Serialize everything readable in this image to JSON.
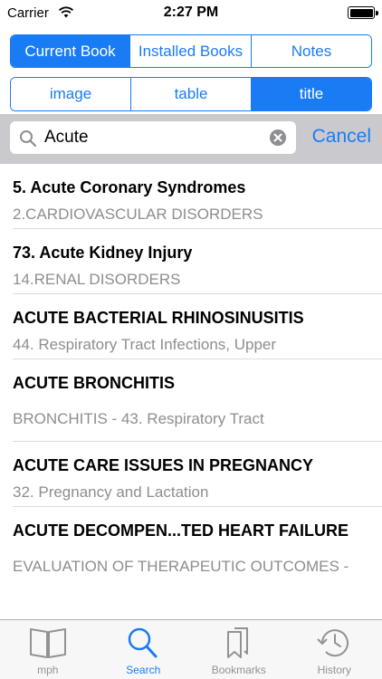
{
  "status_bar": {
    "carrier": "Carrier",
    "time": "2:27 PM"
  },
  "book_tabs": [
    {
      "label": "Current Book",
      "active": true
    },
    {
      "label": "Installed Books",
      "active": false
    },
    {
      "label": "Notes",
      "active": false
    }
  ],
  "filter_tabs": [
    {
      "label": "image",
      "active": false
    },
    {
      "label": "table",
      "active": false
    },
    {
      "label": "title",
      "active": true
    }
  ],
  "search": {
    "value": "Acute",
    "cancel_label": "Cancel"
  },
  "results": [
    {
      "title": "5. Acute Coronary Syndromes",
      "subtitle": "2.CARDIOVASCULAR DISORDERS"
    },
    {
      "title": "73. Acute Kidney Injury",
      "subtitle": "14.RENAL DISORDERS"
    },
    {
      "title": "ACUTE BACTERIAL RHINOSINUSITIS",
      "subtitle": "44. Respiratory Tract Infections, Upper"
    },
    {
      "title": "ACUTE BRONCHITIS",
      "subtitle": "BRONCHITIS - 43. Respiratory Tract"
    },
    {
      "title": "ACUTE CARE ISSUES IN PREGNANCY",
      "subtitle": "32. Pregnancy and Lactation"
    },
    {
      "title": "ACUTE DECOMPEN...TED HEART FAILURE",
      "subtitle": "EVALUATION OF THERAPEUTIC OUTCOMES -"
    }
  ],
  "tab_bar": [
    {
      "label": "mph",
      "icon": "book-icon",
      "active": false
    },
    {
      "label": "Search",
      "icon": "search-icon",
      "active": true
    },
    {
      "label": "Bookmarks",
      "icon": "bookmarks-icon",
      "active": false
    },
    {
      "label": "History",
      "icon": "history-icon",
      "active": false
    }
  ],
  "colors": {
    "accent": "#1a7cf5",
    "secondary_text": "#8e8e93",
    "search_bar_bg": "#c9c9ce"
  }
}
